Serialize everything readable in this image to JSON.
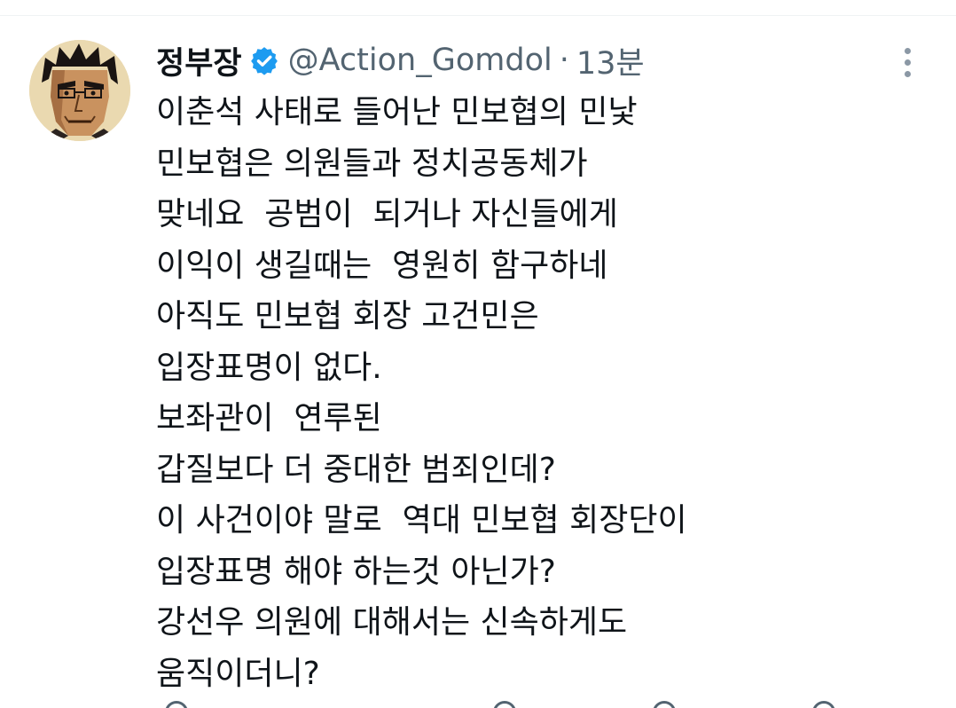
{
  "tweet": {
    "author": {
      "display_name": "정부장",
      "handle": "@Action_Gomdol",
      "verified": true,
      "avatar_icon": "comic-character-avatar"
    },
    "separator": "·",
    "time": "13분",
    "more_icon": "more-options-icon",
    "text_lines": [
      "이춘석 사태로 들어난 민보협의 민낯",
      "민보협은 의원들과 정치공동체가",
      "맞네요  공범이  되거나 자신들에게",
      "이익이 생길때는  영원히 함구하네",
      "아직도 민보협 회장 고건민은",
      "입장표명이 없다.",
      "보좌관이  연루된",
      "갑질보다 더 중대한 범죄인데?",
      "이 사건이야 말로  역대 민보협 회장단이",
      "입장표명 해야 하는것 아닌가?",
      "강선우 의원에 대해서는 신속하게도",
      "움직이더니?"
    ]
  },
  "colors": {
    "text_primary": "#0f1419",
    "text_secondary": "#536471",
    "verified_blue": "#1d9bf0",
    "divider": "#eff3f4"
  }
}
